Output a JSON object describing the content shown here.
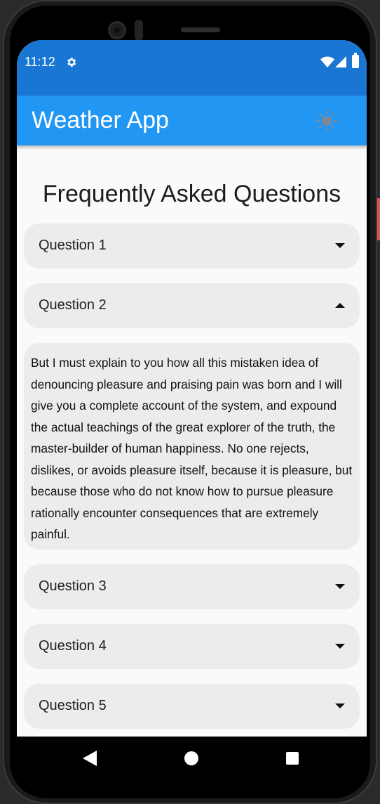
{
  "status_bar": {
    "time": "11:12",
    "icons": [
      "gear-icon",
      "wifi-icon",
      "signal-icon",
      "battery-icon"
    ]
  },
  "app_bar": {
    "title": "Weather App",
    "theme_toggle_icon": "sun-icon",
    "background": "#2196f3"
  },
  "page": {
    "title": "Frequently Asked Questions"
  },
  "faq": [
    {
      "question": "Question 1",
      "expanded": false
    },
    {
      "question": "Question 2",
      "expanded": true,
      "answer": "But I must explain to you how all this mistaken idea of denouncing pleasure and praising pain was born and I will give you a complete account of the system, and expound the actual teachings of the great explorer of the truth, the master-builder of human happiness. No one rejects, dislikes, or avoids pleasure itself, because it is pleasure, but because those who do not know how to pursue pleasure rationally encounter consequences that are extremely painful."
    },
    {
      "question": "Question 3",
      "expanded": false
    },
    {
      "question": "Question 4",
      "expanded": false
    },
    {
      "question": "Question 5",
      "expanded": false
    }
  ],
  "nav_bar": {
    "icons": [
      "back-icon",
      "home-icon",
      "recent-apps-icon"
    ]
  },
  "colors": {
    "status_bar": "#1976d2",
    "app_bar": "#2196f3",
    "card": "#ececec",
    "screen_bg": "#fafafa"
  }
}
